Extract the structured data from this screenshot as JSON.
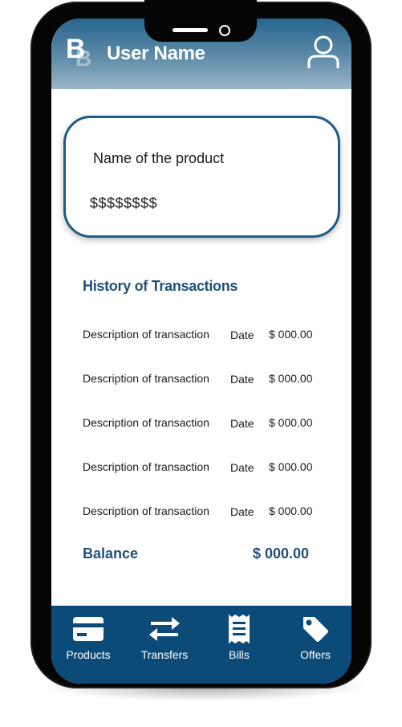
{
  "header": {
    "logo_text": "B",
    "logo_text_shadow": "B",
    "user_name": "User Name",
    "icon": "user-icon"
  },
  "product": {
    "name": "Name of the product",
    "amount": "$$$$$$$$"
  },
  "history": {
    "title": "History of Transactions",
    "transactions": [
      {
        "description": "Description of transaction",
        "date": "Date",
        "amount": "$ 000.00"
      },
      {
        "description": "Description of transaction",
        "date": "Date",
        "amount": "$ 000.00"
      },
      {
        "description": "Description of transaction",
        "date": "Date",
        "amount": "$ 000.00"
      },
      {
        "description": "Description of transaction",
        "date": "Date",
        "amount": "$ 000.00"
      },
      {
        "description": "Description of transaction",
        "date": "Date",
        "amount": "$ 000.00"
      }
    ]
  },
  "balance": {
    "label": "Balance",
    "value": "$ 000.00"
  },
  "nav": {
    "items": [
      {
        "label": "Products",
        "icon": "credit-card-icon"
      },
      {
        "label": "Transfers",
        "icon": "transfer-arrows-icon"
      },
      {
        "label": "Bills",
        "icon": "receipt-icon"
      },
      {
        "label": "Offers",
        "icon": "tag-icon"
      }
    ]
  },
  "colors": {
    "brand": "#0c4a78",
    "accent_text": "#1f4f7a",
    "card_border": "#1f5b86"
  }
}
